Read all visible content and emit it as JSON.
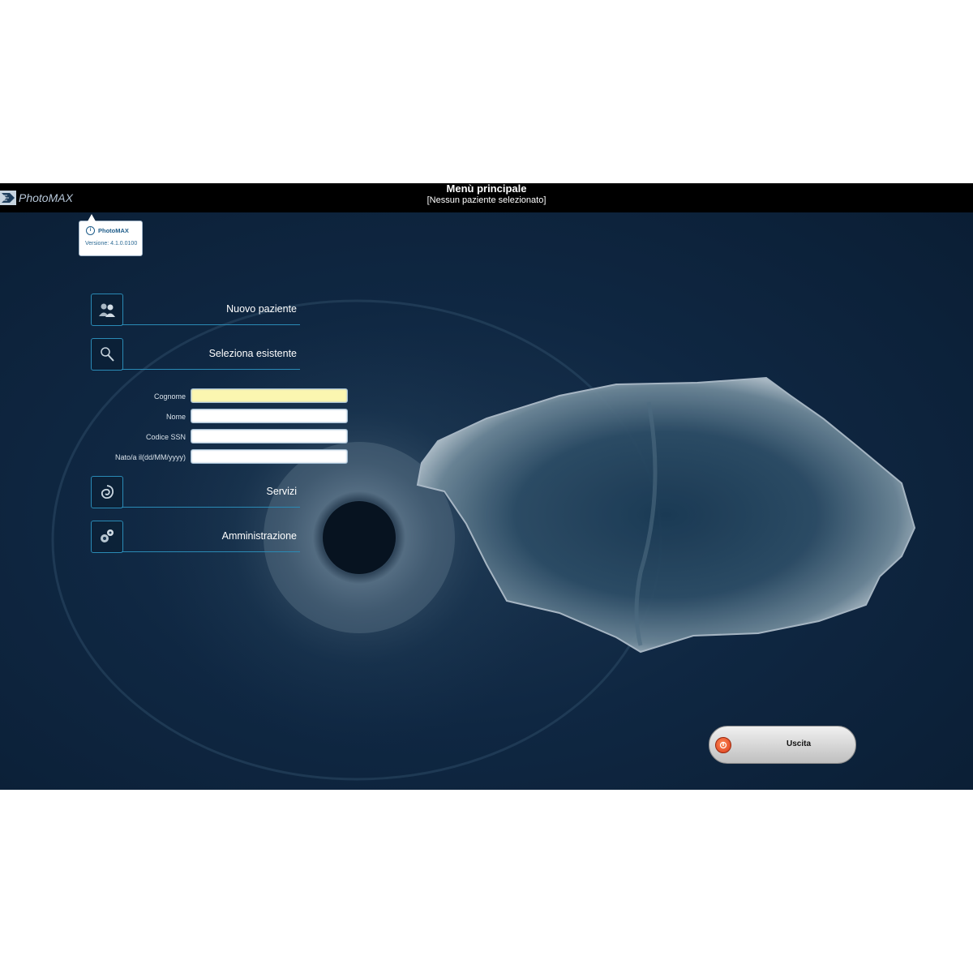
{
  "titlebar": {
    "title": "Menù principale",
    "subtitle": "[Nessun paziente selezionato]",
    "logo_text": "PhotoMAX"
  },
  "tooltip": {
    "title": "PhotoMAX",
    "version": "Versione: 4.1.0.0100"
  },
  "menu": {
    "new_patient": "Nuovo paziente",
    "select_existing": "Seleziona esistente",
    "services": "Servizi",
    "administration": "Amministrazione"
  },
  "search_form": {
    "surname_label": "Cognome",
    "surname_value": "",
    "name_label": "Nome",
    "name_value": "",
    "ssn_label": "Codice SSN",
    "ssn_value": "",
    "birth_label": "Nato/a il(dd/MM/yyyy)",
    "birth_value": ""
  },
  "exit": {
    "label": "Uscita"
  },
  "colors": {
    "background": "#0f2742",
    "accent": "#2a8ab5",
    "titlebar": "#000000",
    "active_field": "#fbf6b0",
    "exit_icon": "#d8381a"
  },
  "icons": [
    "logo-icon",
    "info-icon",
    "users-icon",
    "magnifier-icon",
    "swirl-icon",
    "gears-icon",
    "power-icon"
  ]
}
